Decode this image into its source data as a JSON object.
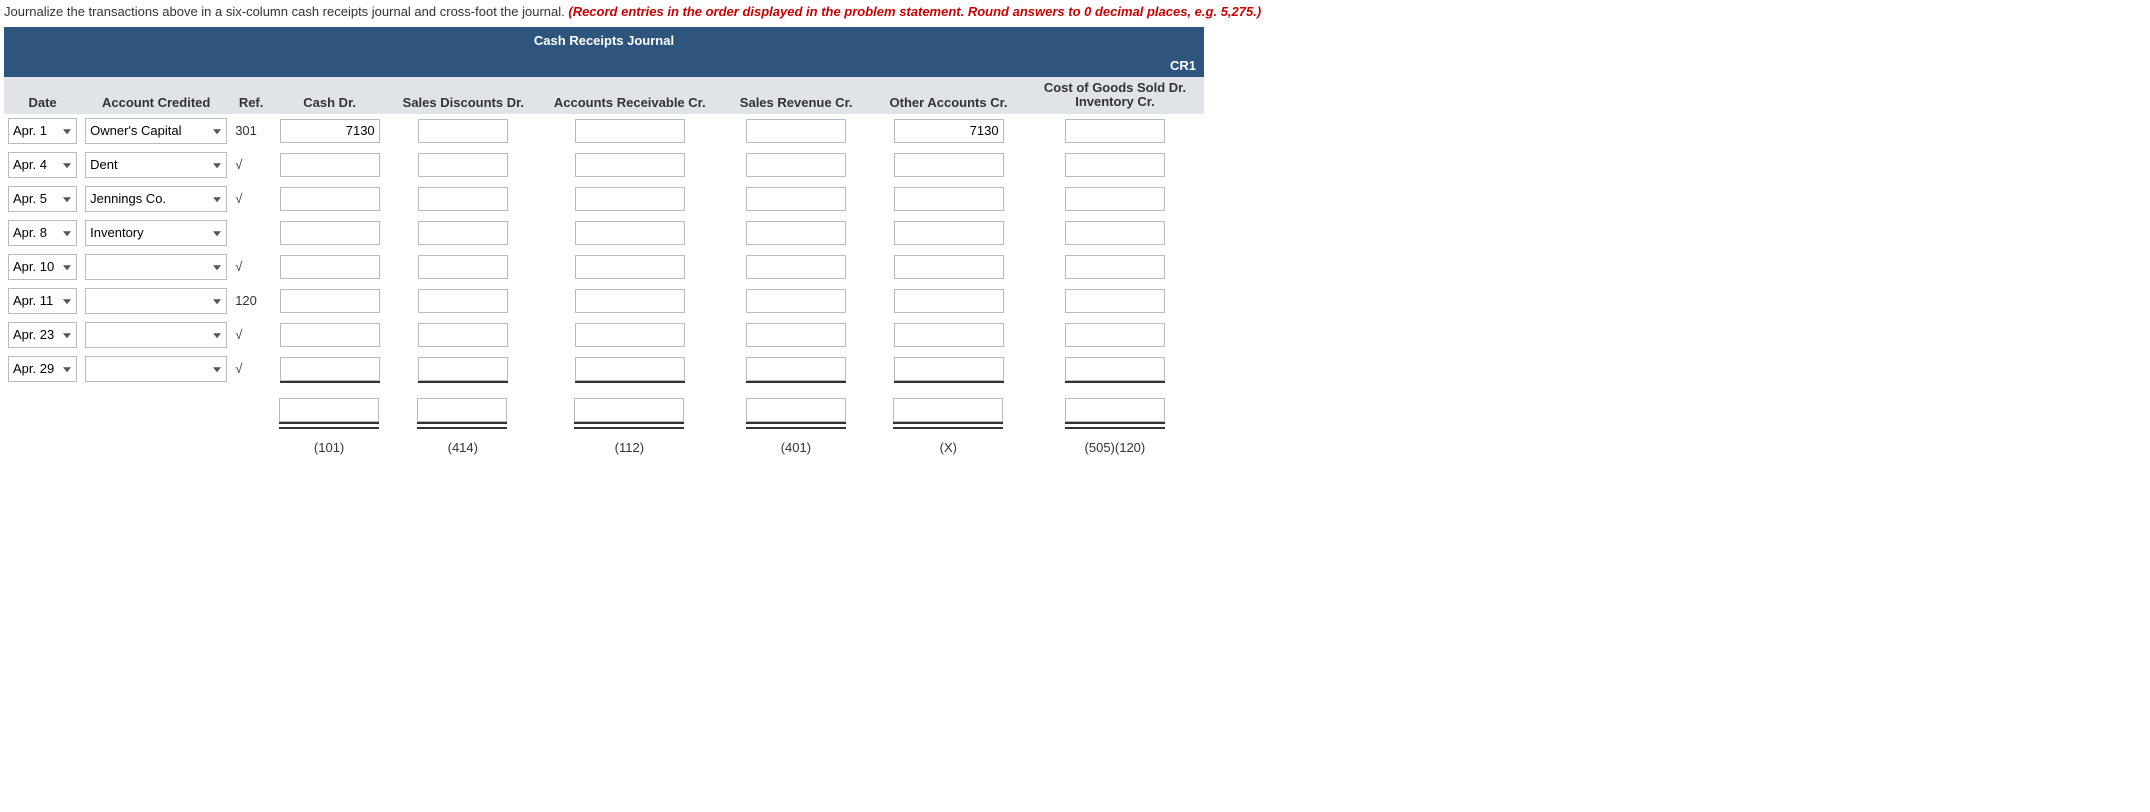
{
  "instructions": {
    "black": "Journalize the transactions above in a six-column cash receipts journal and cross-foot the journal. ",
    "red": "(Record entries in the order displayed in the problem statement. Round answers to 0 decimal places, e.g. 5,275.)"
  },
  "journal": {
    "title": "Cash Receipts Journal",
    "page": "CR1",
    "columns": {
      "date": "Date",
      "account_credited": "Account Credited",
      "ref": "Ref.",
      "cash_dr": "Cash Dr.",
      "sales_discounts_dr": "Sales Discounts Dr.",
      "ar_cr": "Accounts Receivable Cr.",
      "sales_rev_cr": "Sales Revenue Cr.",
      "other_cr": "Other Accounts Cr.",
      "cogs_line1": "Cost of Goods Sold Dr.",
      "cogs_line2": "Inventory Cr."
    },
    "rows": [
      {
        "date": "Apr. 1",
        "account": "Owner's Capital",
        "ref": "301",
        "cash": "7130",
        "sd": "",
        "ar": "",
        "sr": "",
        "oa": "7130",
        "cogs": ""
      },
      {
        "date": "Apr. 4",
        "account": "Dent",
        "ref": "√",
        "cash": "",
        "sd": "",
        "ar": "",
        "sr": "",
        "oa": "",
        "cogs": ""
      },
      {
        "date": "Apr. 5",
        "account": "Jennings Co.",
        "ref": "√",
        "cash": "",
        "sd": "",
        "ar": "",
        "sr": "",
        "oa": "",
        "cogs": ""
      },
      {
        "date": "Apr. 8",
        "account": "Inventory",
        "ref": "",
        "cash": "",
        "sd": "",
        "ar": "",
        "sr": "",
        "oa": "",
        "cogs": ""
      },
      {
        "date": "Apr. 10",
        "account": "",
        "ref": "√",
        "cash": "",
        "sd": "",
        "ar": "",
        "sr": "",
        "oa": "",
        "cogs": ""
      },
      {
        "date": "Apr. 11",
        "account": "",
        "ref": "120",
        "cash": "",
        "sd": "",
        "ar": "",
        "sr": "",
        "oa": "",
        "cogs": ""
      },
      {
        "date": "Apr. 23",
        "account": "",
        "ref": "√",
        "cash": "",
        "sd": "",
        "ar": "",
        "sr": "",
        "oa": "",
        "cogs": ""
      },
      {
        "date": "Apr. 29",
        "account": "",
        "ref": "√",
        "cash": "",
        "sd": "",
        "ar": "",
        "sr": "",
        "oa": "",
        "cogs": ""
      }
    ],
    "totals": {
      "cash": "",
      "sd": "",
      "ar": "",
      "sr": "",
      "oa": "",
      "cogs": ""
    },
    "footer": {
      "cash": "(101)",
      "sd": "(414)",
      "ar": "(112)",
      "sr": "(401)",
      "oa": "(X)",
      "cogs": "(505)(120)"
    }
  }
}
